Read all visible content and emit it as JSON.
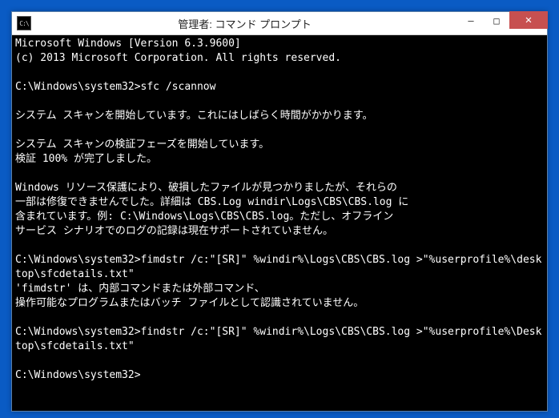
{
  "window": {
    "title": "管理者: コマンド プロンプト",
    "icon_text": "C:\\"
  },
  "controls": {
    "minimize": "—",
    "maximize": "□",
    "close": "✕"
  },
  "terminal_lines": [
    "Microsoft Windows [Version 6.3.9600]",
    "(c) 2013 Microsoft Corporation. All rights reserved.",
    "",
    "C:\\Windows\\system32>sfc /scannow",
    "",
    "システム スキャンを開始しています。これにはしばらく時間がかかります。",
    "",
    "システム スキャンの検証フェーズを開始しています。",
    "検証 100% が完了しました。",
    "",
    "Windows リソース保護により、破損したファイルが見つかりましたが、それらの",
    "一部は修復できませんでした。詳細は CBS.Log windir\\Logs\\CBS\\CBS.log に",
    "含まれています。例: C:\\Windows\\Logs\\CBS\\CBS.log。ただし、オフライン",
    "サービス シナリオでのログの記録は現在サポートされていません。",
    "",
    "C:\\Windows\\system32>fimdstr /c:\"[SR]\" %windir%\\Logs\\CBS\\CBS.log >\"%userprofile%\\desktop\\sfcdetails.txt\"",
    "'fimdstr' は、内部コマンドまたは外部コマンド、",
    "操作可能なプログラムまたはバッチ ファイルとして認識されていません。",
    "",
    "C:\\Windows\\system32>findstr /c:\"[SR]\" %windir%\\Logs\\CBS\\CBS.log >\"%userprofile%\\Desktop\\sfcdetails.txt\"",
    "",
    "C:\\Windows\\system32>"
  ]
}
